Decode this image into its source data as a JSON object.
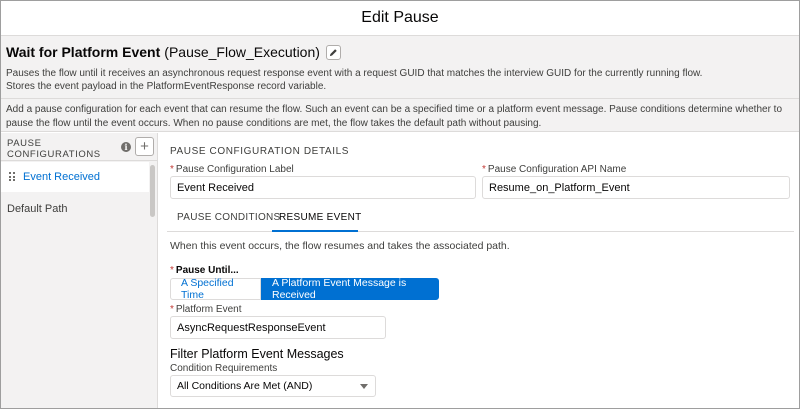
{
  "header": {
    "title": "Edit Pause"
  },
  "element": {
    "title": "Wait for Platform Event",
    "api_name": "(Pause_Flow_Execution)",
    "description_line1": "Pauses the flow until it receives an asynchronous request response event with a request GUID that matches the interview GUID for the currently running flow.",
    "description_line2": "Stores the event payload in the PlatformEventResponse record variable.",
    "help_text": "Add a pause configuration for each event that can resume the flow. Such an event can be a specified time or a platform event message. Pause conditions determine whether to pause the flow until the event occurs. When no pause conditions are met, the flow takes the default path without pausing."
  },
  "sidebar": {
    "heading": "PAUSE CONFIGURATIONS",
    "info_glyph": "i",
    "add_glyph": "+",
    "items": [
      {
        "label": "Event Received"
      },
      {
        "label": "Default Path"
      }
    ]
  },
  "details": {
    "section_title": "PAUSE CONFIGURATION DETAILS",
    "label_field": {
      "label": "Pause Configuration Label",
      "value": "Event Received"
    },
    "api_field": {
      "label": "Pause Configuration API Name",
      "value": "Resume_on_Platform_Event"
    },
    "required_mark": "*"
  },
  "tabs": [
    {
      "label": "PAUSE CONDITIONS"
    },
    {
      "label": "RESUME EVENT"
    }
  ],
  "resume_event": {
    "intro": "When this event occurs, the flow resumes and takes the associated path.",
    "pause_until_label": "Pause Until...",
    "options": [
      "A Specified Time",
      "A Platform Event Message is Received"
    ],
    "platform_event": {
      "label": "Platform Event",
      "value": "AsyncRequestResponseEvent"
    },
    "filter_title": "Filter Platform Event Messages",
    "condition": {
      "label": "Condition Requirements",
      "value": "All Conditions Are Met (AND)"
    }
  },
  "colors": {
    "brand": "#0070d2",
    "required": "#c23934",
    "panel": "#f3f2f2"
  }
}
